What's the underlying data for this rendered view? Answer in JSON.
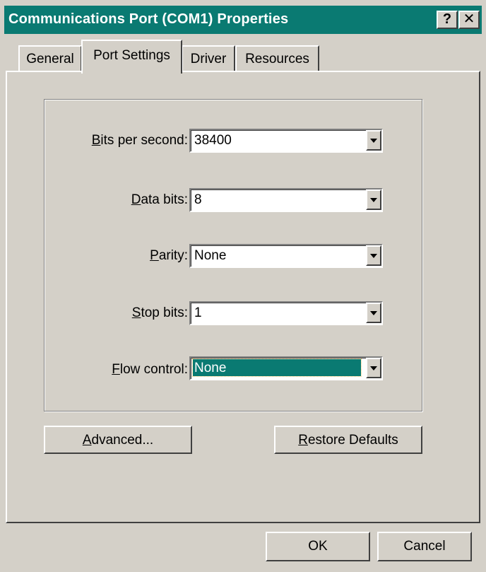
{
  "window": {
    "title": "Communications Port (COM1) Properties",
    "help_button": "?",
    "close_button": "✕"
  },
  "tabs": [
    {
      "label": "General",
      "active": false
    },
    {
      "label": "Port Settings",
      "active": true
    },
    {
      "label": "Driver",
      "active": false
    },
    {
      "label": "Resources",
      "active": false
    }
  ],
  "settings": {
    "bits_per_second": {
      "label_prefix": "",
      "label_accel": "B",
      "label_rest": "its per second:",
      "value": "38400"
    },
    "data_bits": {
      "label_prefix": "",
      "label_accel": "D",
      "label_rest": "ata bits:",
      "value": "8"
    },
    "parity": {
      "label_prefix": "",
      "label_accel": "P",
      "label_rest": "arity:",
      "value": "None"
    },
    "stop_bits": {
      "label_prefix": "",
      "label_accel": "S",
      "label_rest": "top bits:",
      "value": "1"
    },
    "flow_control": {
      "label_prefix": "",
      "label_accel": "F",
      "label_rest": "low control:",
      "value": "None"
    }
  },
  "buttons": {
    "advanced": {
      "accel": "A",
      "rest": "dvanced..."
    },
    "restore": {
      "accel": "R",
      "rest": "estore Defaults"
    },
    "ok": "OK",
    "cancel": "Cancel"
  },
  "colors": {
    "title_bar": "#0a7a72",
    "face": "#d4d0c8",
    "selection": "#0a7a72"
  }
}
